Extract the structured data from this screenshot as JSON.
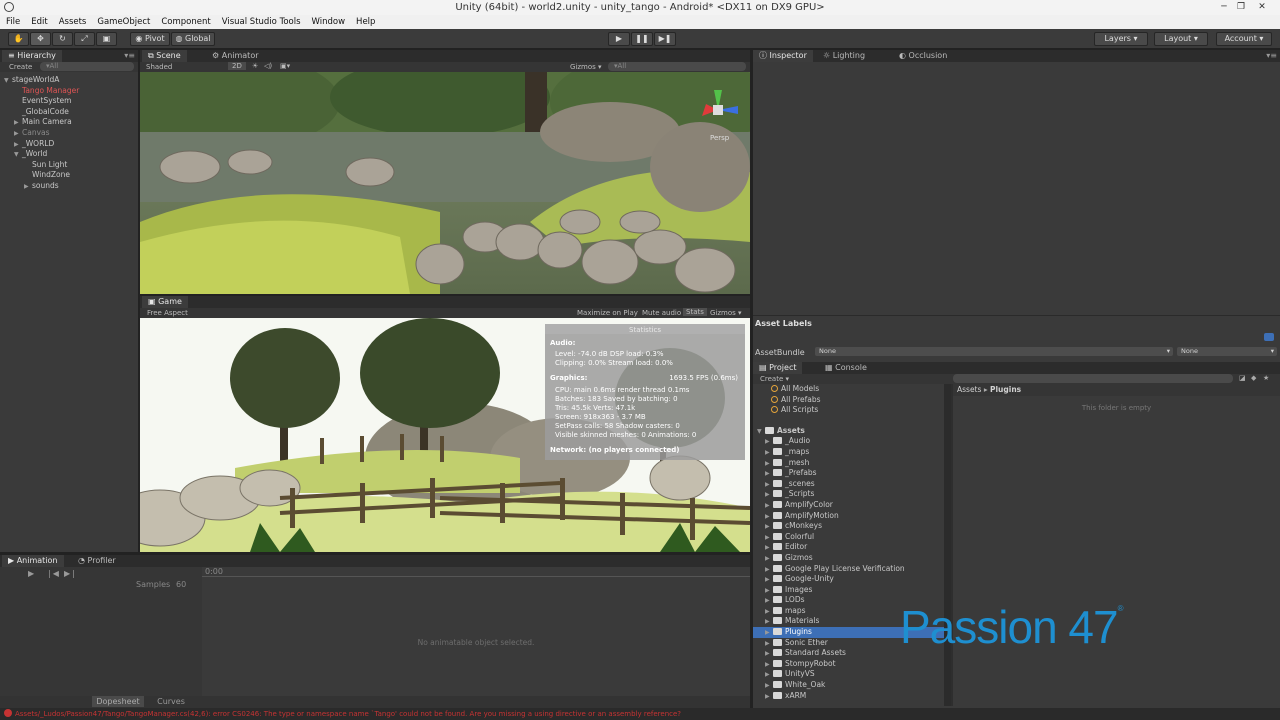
{
  "window": {
    "title": "Unity (64bit) - world2.unity - unity_tango - Android* <DX11 on DX9 GPU>"
  },
  "menu": [
    "File",
    "Edit",
    "Assets",
    "GameObject",
    "Component",
    "Visual Studio Tools",
    "Window",
    "Help"
  ],
  "toolbar": {
    "pivot": "Pivot",
    "global": "Global",
    "layers": "Layers",
    "layout": "Layout",
    "account": "Account"
  },
  "hierarchy": {
    "tab": "Hierarchy",
    "create": "Create",
    "search": "▾All",
    "items": [
      {
        "label": "stageWorldA",
        "indent": 0,
        "arrow": "▼",
        "color": "#c8c8c8"
      },
      {
        "label": "Tango Manager",
        "indent": 1,
        "arrow": "",
        "color": "#e05555"
      },
      {
        "label": "EventSystem",
        "indent": 1,
        "arrow": "",
        "color": "#c8c8c8"
      },
      {
        "label": "_GlobalCode",
        "indent": 1,
        "arrow": "",
        "color": "#c8c8c8"
      },
      {
        "label": "Main Camera",
        "indent": 1,
        "arrow": "▶",
        "color": "#c8c8c8"
      },
      {
        "label": "Canvas",
        "indent": 1,
        "arrow": "▶",
        "color": "#8a8a8a"
      },
      {
        "label": "_WORLD",
        "indent": 1,
        "arrow": "▶",
        "color": "#c8c8c8"
      },
      {
        "label": "_World",
        "indent": 1,
        "arrow": "▼",
        "color": "#c8c8c8"
      },
      {
        "label": "Sun Light",
        "indent": 2,
        "arrow": "",
        "color": "#c8c8c8"
      },
      {
        "label": "WindZone",
        "indent": 2,
        "arrow": "",
        "color": "#c8c8c8"
      },
      {
        "label": "sounds",
        "indent": 2,
        "arrow": "▶",
        "color": "#c8c8c8"
      }
    ]
  },
  "scene": {
    "tab": "Scene",
    "tab2": "Animator",
    "shaded": "Shaded",
    "mode2d": "2D",
    "gizmos": "Gizmos ▾",
    "search": "▾All",
    "persp": "Persp"
  },
  "game": {
    "tab": "Game",
    "aspect": "Free Aspect",
    "maximize": "Maximize on Play",
    "mute": "Mute audio",
    "stats": "Stats",
    "gizmos": "Gizmos ▾",
    "stats_panel": {
      "header": "Statistics",
      "audio_title": "Audio:",
      "audio_lines": [
        "Level: -74.0 dB          DSP load: 0.3%",
        "Clipping: 0.0%           Stream load: 0.0%"
      ],
      "graphics_title": "Graphics:",
      "fps": "1693.5 FPS (0.6ms)",
      "graphics_lines": [
        "CPU: main 0.6ms  render thread 0.1ms",
        "Batches: 183       Saved by batching: 0",
        "Tris: 45.5k          Verts: 47.1k",
        "Screen: 918x363 - 3.7 MB",
        "SetPass calls: 58     Shadow casters: 0",
        "Visible skinned meshes: 0  Animations: 0"
      ],
      "network": "Network: (no players connected)"
    }
  },
  "animation": {
    "tab": "Animation",
    "tab2": "Profiler",
    "samples_label": "Samples",
    "samples_value": "60",
    "time": "0:00",
    "empty": "No animatable object selected.",
    "dopesheet": "Dopesheet",
    "curves": "Curves"
  },
  "inspector": {
    "tab": "Inspector",
    "tab2": "Lighting",
    "tab3": "Occlusion"
  },
  "asset_labels": {
    "title": "Asset Labels",
    "bundle_label": "AssetBundle",
    "bundle_value": "None",
    "variant_value": "None"
  },
  "project": {
    "tab": "Project",
    "tab2": "Console",
    "create": "Create ▾",
    "favorites": [
      "All Models",
      "All Prefabs",
      "All Scripts"
    ],
    "root": "Assets",
    "folders": [
      "_Audio",
      "_maps",
      "_mesh",
      "_Prefabs",
      "_scenes",
      "_Scripts",
      "AmplifyColor",
      "AmplifyMotion",
      "cMonkeys",
      "Colorful",
      "Editor",
      "Gizmos",
      "Google Play License Verification",
      "Google-Unity",
      "Images",
      "LODs",
      "maps",
      "Materials",
      "Plugins",
      "Sonic Ether",
      "Standard Assets",
      "StompyRobot",
      "UnityVS",
      "White_Oak",
      "xARM"
    ],
    "selected": "Plugins",
    "breadcrumb_root": "Assets",
    "breadcrumb_sep": "▸",
    "breadcrumb_current": "Plugins",
    "empty": "This folder is empty"
  },
  "watermark": "Passion 47",
  "watermark_mark": "®",
  "status": "Assets/_Ludos/Passion47/Tango/TangoManager.cs(42,6): error CS0246: The type or namespace name `Tango' could not be found. Are you missing a using directive or an assembly reference?",
  "colors": {
    "selected_row": "#3d6fb6",
    "error": "#c63333",
    "watermark": "#1e8fd0"
  }
}
